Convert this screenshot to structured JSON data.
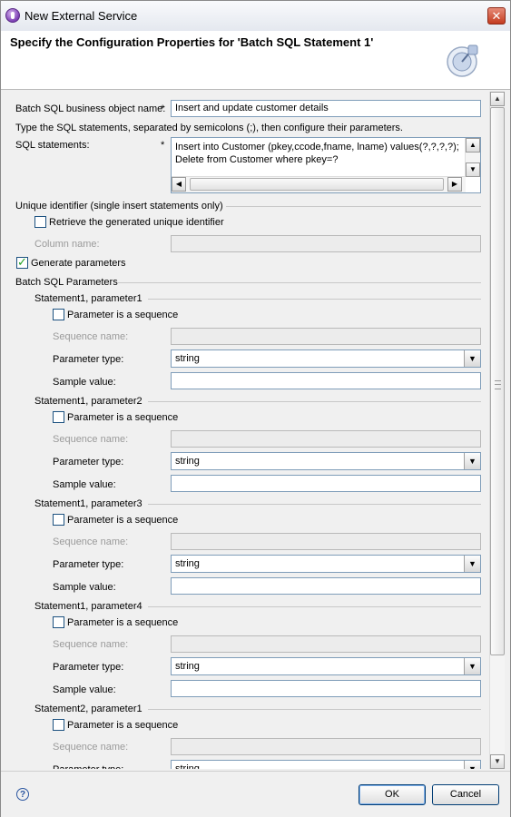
{
  "window": {
    "title": "New External Service",
    "close_label": "✕"
  },
  "header": {
    "heading": "Specify the Configuration Properties for 'Batch SQL Statement 1'"
  },
  "form": {
    "bo_name_label": "Batch SQL business object name:",
    "required_marker": "*",
    "bo_name_value": "Insert and update customer details",
    "instructions": "Type the SQL statements, separated by semicolons (;), then configure their parameters.",
    "sql_label": "SQL statements:",
    "sql_line1": "Insert into Customer (pkey,ccode,fname, lname) values(?,?,?,?);",
    "sql_line2": "Delete from Customer where pkey=?",
    "unique_section": "Unique identifier (single insert statements only)",
    "retrieve_label": "Retrieve the generated unique identifier",
    "column_name_label": "Column name:",
    "generate_label": "Generate parameters",
    "batch_params_section": "Batch SQL Parameters"
  },
  "param_labels": {
    "is_sequence": "Parameter is a sequence",
    "sequence_name": "Sequence name:",
    "parameter_type": "Parameter type:",
    "sample_value": "Sample value:"
  },
  "params": [
    {
      "title": "Statement1, parameter1",
      "type": "string"
    },
    {
      "title": "Statement1, parameter2",
      "type": "string"
    },
    {
      "title": "Statement1, parameter3",
      "type": "string"
    },
    {
      "title": "Statement1, parameter4",
      "type": "string"
    },
    {
      "title": "Statement2, parameter1",
      "type": "string"
    }
  ],
  "footer": {
    "help_label": "?",
    "ok_label": "OK",
    "cancel_label": "Cancel"
  }
}
